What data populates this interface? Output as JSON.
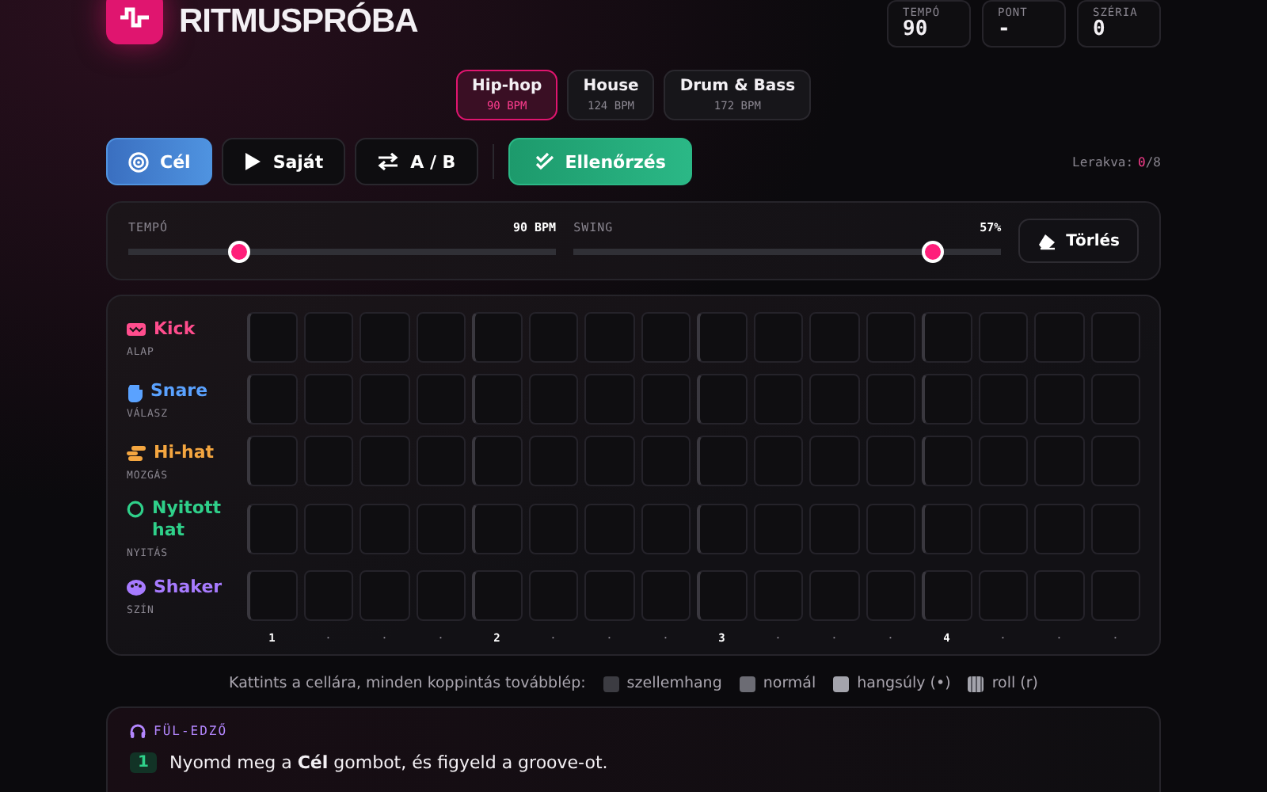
{
  "header": {
    "title": "RITMUSPRÓBA",
    "stats": [
      {
        "label": "TEMPÓ",
        "value": "90"
      },
      {
        "label": "PONT",
        "value": "-"
      },
      {
        "label": "SZÉRIA",
        "value": "0"
      }
    ]
  },
  "genres": [
    {
      "name": "Hip-hop",
      "bpm": "90 BPM",
      "selected": true
    },
    {
      "name": "House",
      "bpm": "124 BPM",
      "selected": false
    },
    {
      "name": "Drum & Bass",
      "bpm": "172 BPM",
      "selected": false
    }
  ],
  "modes": [
    {
      "label": "Cél",
      "kind": "target",
      "selected": true
    },
    {
      "label": "Saját",
      "kind": "play",
      "selected": false
    },
    {
      "label": "A / B",
      "kind": "swap",
      "selected": false
    }
  ],
  "check_button": "Ellenőrzés",
  "placed": {
    "label": "Lerakva:",
    "count": "0",
    "total": "/8"
  },
  "sliders": [
    {
      "label": "TEMPÓ",
      "reading": "90 BPM",
      "level": 0.26
    },
    {
      "label": "SWING",
      "reading": "57%",
      "level": 0.84
    }
  ],
  "clear_button": "Törlés",
  "tracks": [
    {
      "name": "Kick",
      "role": "ALAP",
      "kind": "kick",
      "color": "#ff4d8d",
      "steps": [
        {
          "filled": false
        },
        {
          "filled": false
        },
        {
          "filled": false
        },
        {
          "filled": false
        },
        {
          "filled": false
        },
        {
          "filled": false
        },
        {
          "filled": false
        },
        {
          "filled": false
        },
        {
          "filled": false
        },
        {
          "filled": false
        },
        {
          "filled": false
        },
        {
          "filled": false
        },
        {
          "filled": false
        },
        {
          "filled": false
        },
        {
          "filled": false
        },
        {
          "filled": false
        }
      ]
    },
    {
      "name": "Snare",
      "role": "VÁLASZ",
      "kind": "snare",
      "color": "#5aa2ff",
      "steps": [
        {
          "filled": false
        },
        {
          "filled": false
        },
        {
          "filled": false
        },
        {
          "filled": false
        },
        {
          "filled": false
        },
        {
          "filled": false
        },
        {
          "filled": false
        },
        {
          "filled": false
        },
        {
          "filled": false
        },
        {
          "filled": false
        },
        {
          "filled": false
        },
        {
          "filled": false
        },
        {
          "filled": false
        },
        {
          "filled": false
        },
        {
          "filled": false
        },
        {
          "filled": false
        }
      ]
    },
    {
      "name": "Hi-hat",
      "role": "MOZGÁS",
      "kind": "hihat",
      "color": "#f4a640",
      "steps": [
        {
          "filled": false
        },
        {
          "filled": false
        },
        {
          "filled": false
        },
        {
          "filled": false
        },
        {
          "filled": false
        },
        {
          "filled": false
        },
        {
          "filled": false
        },
        {
          "filled": false
        },
        {
          "filled": false
        },
        {
          "filled": false
        },
        {
          "filled": false
        },
        {
          "filled": false
        },
        {
          "filled": false
        },
        {
          "filled": false
        },
        {
          "filled": false
        },
        {
          "filled": false
        }
      ]
    },
    {
      "name": "Nyitott hat",
      "role": "NYITÁS",
      "kind": "openhat",
      "color": "#2fd08a",
      "steps": [
        {
          "filled": false
        },
        {
          "filled": false
        },
        {
          "filled": false
        },
        {
          "filled": false
        },
        {
          "filled": false
        },
        {
          "filled": false
        },
        {
          "filled": false
        },
        {
          "filled": false
        },
        {
          "filled": false
        },
        {
          "filled": false
        },
        {
          "filled": false
        },
        {
          "filled": false
        },
        {
          "filled": false
        },
        {
          "filled": false
        },
        {
          "filled": false
        },
        {
          "filled": false
        }
      ]
    },
    {
      "name": "Shaker",
      "role": "SZÍN",
      "kind": "shaker",
      "color": "#a77bff",
      "steps": [
        {
          "filled": false
        },
        {
          "filled": false
        },
        {
          "filled": false
        },
        {
          "filled": false
        },
        {
          "filled": false
        },
        {
          "filled": false
        },
        {
          "filled": false
        },
        {
          "filled": false
        },
        {
          "filled": false
        },
        {
          "filled": false
        },
        {
          "filled": false
        },
        {
          "filled": false
        },
        {
          "filled": false
        },
        {
          "filled": false
        },
        {
          "filled": false
        },
        {
          "filled": false
        }
      ]
    }
  ],
  "step_labels": [
    "1",
    "·",
    "·",
    "·",
    "2",
    "·",
    "·",
    "·",
    "3",
    "·",
    "·",
    "·",
    "4",
    "·",
    "·",
    "·"
  ],
  "legend": {
    "intro": "Kattints a cellára, minden koppintás továbblép:",
    "items": [
      {
        "label": "szellemhang",
        "kind": "ghost"
      },
      {
        "label": "normál",
        "kind": "normal"
      },
      {
        "label": "hangsúly (•)",
        "kind": "accent"
      },
      {
        "label": "roll (r)",
        "kind": "roll"
      }
    ]
  },
  "ear_trainer": {
    "title": "FÜL-EDZŐ",
    "steps": [
      {
        "number": "1",
        "text": "Nyomd meg a **Cél** gombot, és figyeld a groove-ot."
      }
    ]
  }
}
